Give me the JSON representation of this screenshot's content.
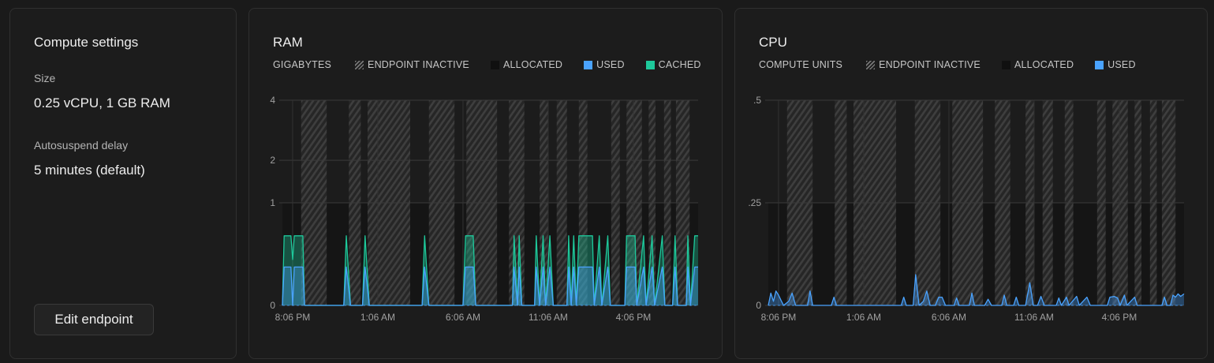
{
  "settings": {
    "title": "Compute settings",
    "size_label": "Size",
    "size_value": "0.25 vCPU, 1 GB RAM",
    "autosuspend_label": "Autosuspend delay",
    "autosuspend_value": "5 minutes (default)",
    "edit_button": "Edit endpoint"
  },
  "colors": {
    "background": "#1a1a1a",
    "card": "#1c1c1c",
    "used": "#4aa3ff",
    "cached": "#1ec99b",
    "allocated": "#101010",
    "inactive_hatch": "#777777"
  },
  "chart_data": [
    {
      "type": "area",
      "title": "RAM",
      "unit_label": "GIGABYTES",
      "legend": [
        {
          "label": "ENDPOINT INACTIVE",
          "swatch": "inactive"
        },
        {
          "label": "ALLOCATED",
          "swatch": "allocated"
        },
        {
          "label": "USED",
          "swatch": "used"
        },
        {
          "label": "CACHED",
          "swatch": "cached"
        }
      ],
      "y_ticks": [
        {
          "value": 0,
          "label": "0"
        },
        {
          "value": 1,
          "label": "1"
        },
        {
          "value": 2,
          "label": "2"
        },
        {
          "value": 4,
          "label": "4"
        }
      ],
      "ylim": [
        0,
        4
      ],
      "y_scale": "sqrt",
      "x_ticks": [
        "8:06 PM",
        "1:06 AM",
        "6:06 AM",
        "11:06 AM",
        "4:06 PM"
      ],
      "x_tick_hours": [
        0,
        5,
        10,
        15,
        20
      ],
      "x_range_hours": [
        -0.6,
        23.8
      ],
      "allocated_gb": 1,
      "inactive_ranges": [
        [
          0.5,
          2.0
        ],
        [
          3.3,
          4.0
        ],
        [
          4.4,
          6.9
        ],
        [
          8.0,
          9.5
        ],
        [
          10.2,
          12.0
        ],
        [
          12.7,
          13.6
        ],
        [
          14.5,
          15.0
        ],
        [
          15.5,
          16.1
        ],
        [
          16.8,
          17.3
        ],
        [
          18.7,
          19.2
        ],
        [
          19.6,
          20.5
        ],
        [
          20.9,
          21.3
        ],
        [
          21.8,
          22.2
        ],
        [
          22.5,
          23.3
        ]
      ],
      "series": [
        {
          "name": "USED",
          "color": "#4aa3ff",
          "points": [
            [
              -0.6,
              0
            ],
            [
              -0.5,
              0.14
            ],
            [
              -0.1,
              0.14
            ],
            [
              0,
              0
            ],
            [
              0.1,
              0.14
            ],
            [
              0.6,
              0.14
            ],
            [
              0.7,
              0
            ],
            [
              3.0,
              0
            ],
            [
              3.15,
              0.14
            ],
            [
              3.4,
              0
            ],
            [
              4.1,
              0
            ],
            [
              4.25,
              0.14
            ],
            [
              4.5,
              0
            ],
            [
              7.6,
              0
            ],
            [
              7.75,
              0.14
            ],
            [
              8.0,
              0
            ],
            [
              10.0,
              0
            ],
            [
              10.15,
              0.14
            ],
            [
              10.6,
              0.14
            ],
            [
              10.75,
              0
            ],
            [
              12.9,
              0
            ],
            [
              13.0,
              0.14
            ],
            [
              13.2,
              0
            ],
            [
              13.3,
              0.14
            ],
            [
              13.45,
              0
            ],
            [
              14.2,
              0
            ],
            [
              14.3,
              0.14
            ],
            [
              14.5,
              0
            ],
            [
              14.7,
              0.14
            ],
            [
              14.85,
              0
            ],
            [
              15.1,
              0.14
            ],
            [
              15.3,
              0
            ],
            [
              16.1,
              0
            ],
            [
              16.2,
              0.14
            ],
            [
              16.35,
              0
            ],
            [
              16.5,
              0.14
            ],
            [
              16.65,
              0
            ],
            [
              16.8,
              0.14
            ],
            [
              17.6,
              0.14
            ],
            [
              17.7,
              0
            ],
            [
              18.0,
              0.14
            ],
            [
              18.15,
              0
            ],
            [
              18.5,
              0.14
            ],
            [
              18.65,
              0
            ],
            [
              19.5,
              0
            ],
            [
              19.6,
              0.14
            ],
            [
              20.1,
              0.14
            ],
            [
              20.2,
              0
            ],
            [
              20.6,
              0.14
            ],
            [
              20.75,
              0
            ],
            [
              21.1,
              0.14
            ],
            [
              21.25,
              0
            ],
            [
              21.7,
              0.14
            ],
            [
              21.85,
              0
            ],
            [
              22.3,
              0
            ],
            [
              22.45,
              0.14
            ],
            [
              22.6,
              0
            ],
            [
              23.1,
              0
            ],
            [
              23.2,
              0.14
            ],
            [
              23.35,
              0
            ],
            [
              23.6,
              0.14
            ],
            [
              23.8,
              0.14
            ]
          ]
        },
        {
          "name": "CACHED",
          "color": "#1ec99b",
          "points": [
            [
              -0.6,
              0
            ],
            [
              -0.5,
              0.46
            ],
            [
              -0.1,
              0.46
            ],
            [
              0,
              0.2
            ],
            [
              0.1,
              0.46
            ],
            [
              0.6,
              0.46
            ],
            [
              0.7,
              0
            ],
            [
              3.0,
              0
            ],
            [
              3.15,
              0.46
            ],
            [
              3.4,
              0
            ],
            [
              4.1,
              0
            ],
            [
              4.25,
              0.46
            ],
            [
              4.5,
              0
            ],
            [
              7.6,
              0
            ],
            [
              7.75,
              0.46
            ],
            [
              8.0,
              0
            ],
            [
              10.0,
              0
            ],
            [
              10.15,
              0.46
            ],
            [
              10.6,
              0.46
            ],
            [
              10.75,
              0
            ],
            [
              12.9,
              0
            ],
            [
              13.0,
              0.46
            ],
            [
              13.2,
              0
            ],
            [
              13.3,
              0.46
            ],
            [
              13.45,
              0
            ],
            [
              14.2,
              0
            ],
            [
              14.3,
              0.46
            ],
            [
              14.5,
              0
            ],
            [
              14.7,
              0.46
            ],
            [
              14.85,
              0
            ],
            [
              15.1,
              0.46
            ],
            [
              15.3,
              0
            ],
            [
              16.1,
              0
            ],
            [
              16.2,
              0.46
            ],
            [
              16.35,
              0
            ],
            [
              16.5,
              0.46
            ],
            [
              16.65,
              0
            ],
            [
              16.8,
              0.46
            ],
            [
              17.6,
              0.46
            ],
            [
              17.7,
              0
            ],
            [
              18.0,
              0.46
            ],
            [
              18.15,
              0
            ],
            [
              18.5,
              0.46
            ],
            [
              18.65,
              0
            ],
            [
              19.5,
              0
            ],
            [
              19.6,
              0.46
            ],
            [
              20.1,
              0.46
            ],
            [
              20.2,
              0
            ],
            [
              20.6,
              0.46
            ],
            [
              20.75,
              0
            ],
            [
              21.1,
              0.46
            ],
            [
              21.25,
              0
            ],
            [
              21.7,
              0.46
            ],
            [
              21.85,
              0
            ],
            [
              22.3,
              0
            ],
            [
              22.45,
              0.46
            ],
            [
              22.6,
              0
            ],
            [
              23.1,
              0
            ],
            [
              23.2,
              0.46
            ],
            [
              23.35,
              0
            ],
            [
              23.6,
              0.46
            ],
            [
              23.8,
              0.46
            ]
          ]
        }
      ]
    },
    {
      "type": "line",
      "title": "CPU",
      "unit_label": "COMPUTE UNITS",
      "legend": [
        {
          "label": "ENDPOINT INACTIVE",
          "swatch": "inactive"
        },
        {
          "label": "ALLOCATED",
          "swatch": "allocated"
        },
        {
          "label": "USED",
          "swatch": "used"
        }
      ],
      "y_ticks": [
        {
          "value": 0,
          "label": "0"
        },
        {
          "value": 0.25,
          "label": ".25"
        },
        {
          "value": 0.5,
          "label": ".5"
        }
      ],
      "ylim": [
        0,
        0.5
      ],
      "y_scale": "linear",
      "x_ticks": [
        "8:06 PM",
        "1:06 AM",
        "6:06 AM",
        "11:06 AM",
        "4:06 PM"
      ],
      "x_tick_hours": [
        0,
        5,
        10,
        15,
        20
      ],
      "x_range_hours": [
        -0.6,
        23.8
      ],
      "allocated_cu": 0.25,
      "inactive_ranges": [
        [
          0.5,
          2.0
        ],
        [
          3.3,
          4.0
        ],
        [
          4.4,
          6.9
        ],
        [
          8.0,
          9.5
        ],
        [
          10.2,
          12.0
        ],
        [
          12.7,
          13.6
        ],
        [
          14.5,
          15.0
        ],
        [
          15.5,
          16.1
        ],
        [
          16.8,
          17.3
        ],
        [
          18.7,
          19.2
        ],
        [
          19.6,
          20.5
        ],
        [
          20.9,
          21.3
        ],
        [
          21.8,
          22.2
        ],
        [
          22.5,
          23.3
        ]
      ],
      "series": [
        {
          "name": "USED",
          "color": "#4aa3ff",
          "points": [
            [
              -0.6,
              0
            ],
            [
              -0.45,
              0.03
            ],
            [
              -0.3,
              0.01
            ],
            [
              -0.15,
              0.035
            ],
            [
              0,
              0.025
            ],
            [
              0.15,
              0.012
            ],
            [
              0.3,
              0
            ],
            [
              0.6,
              0.01
            ],
            [
              0.8,
              0.03
            ],
            [
              1.0,
              0
            ],
            [
              1.7,
              0
            ],
            [
              1.85,
              0.035
            ],
            [
              2.0,
              0
            ],
            [
              3.1,
              0
            ],
            [
              3.25,
              0.02
            ],
            [
              3.4,
              0
            ],
            [
              5.0,
              0
            ],
            [
              7.2,
              0
            ],
            [
              7.35,
              0.02
            ],
            [
              7.5,
              0
            ],
            [
              7.9,
              0
            ],
            [
              8.05,
              0.075
            ],
            [
              8.25,
              0
            ],
            [
              8.5,
              0.01
            ],
            [
              8.7,
              0.035
            ],
            [
              8.9,
              0
            ],
            [
              9.2,
              0
            ],
            [
              9.4,
              0.02
            ],
            [
              9.6,
              0.02
            ],
            [
              9.8,
              0
            ],
            [
              10.3,
              0
            ],
            [
              10.45,
              0.018
            ],
            [
              10.6,
              0
            ],
            [
              11.2,
              0
            ],
            [
              11.35,
              0.03
            ],
            [
              11.5,
              0
            ],
            [
              12.1,
              0
            ],
            [
              12.3,
              0.015
            ],
            [
              12.5,
              0
            ],
            [
              13.1,
              0
            ],
            [
              13.25,
              0.025
            ],
            [
              13.4,
              0
            ],
            [
              13.8,
              0
            ],
            [
              13.95,
              0.02
            ],
            [
              14.1,
              0
            ],
            [
              14.5,
              0
            ],
            [
              14.75,
              0.055
            ],
            [
              14.95,
              0
            ],
            [
              15.2,
              0
            ],
            [
              15.4,
              0.022
            ],
            [
              15.6,
              0
            ],
            [
              16.3,
              0
            ],
            [
              16.45,
              0.018
            ],
            [
              16.6,
              0
            ],
            [
              16.9,
              0.02
            ],
            [
              17.05,
              0
            ],
            [
              17.5,
              0.022
            ],
            [
              17.65,
              0
            ],
            [
              18.1,
              0.02
            ],
            [
              18.3,
              0
            ],
            [
              19.3,
              0
            ],
            [
              19.45,
              0.02
            ],
            [
              19.7,
              0.022
            ],
            [
              19.9,
              0.018
            ],
            [
              20.05,
              0
            ],
            [
              20.3,
              0.025
            ],
            [
              20.45,
              0
            ],
            [
              20.9,
              0.02
            ],
            [
              21.05,
              0
            ],
            [
              22.5,
              0
            ],
            [
              22.65,
              0.02
            ],
            [
              22.8,
              0
            ],
            [
              23.0,
              0
            ],
            [
              23.15,
              0.025
            ],
            [
              23.3,
              0.02
            ],
            [
              23.45,
              0.028
            ],
            [
              23.6,
              0.022
            ],
            [
              23.8,
              0.028
            ]
          ]
        }
      ]
    }
  ]
}
